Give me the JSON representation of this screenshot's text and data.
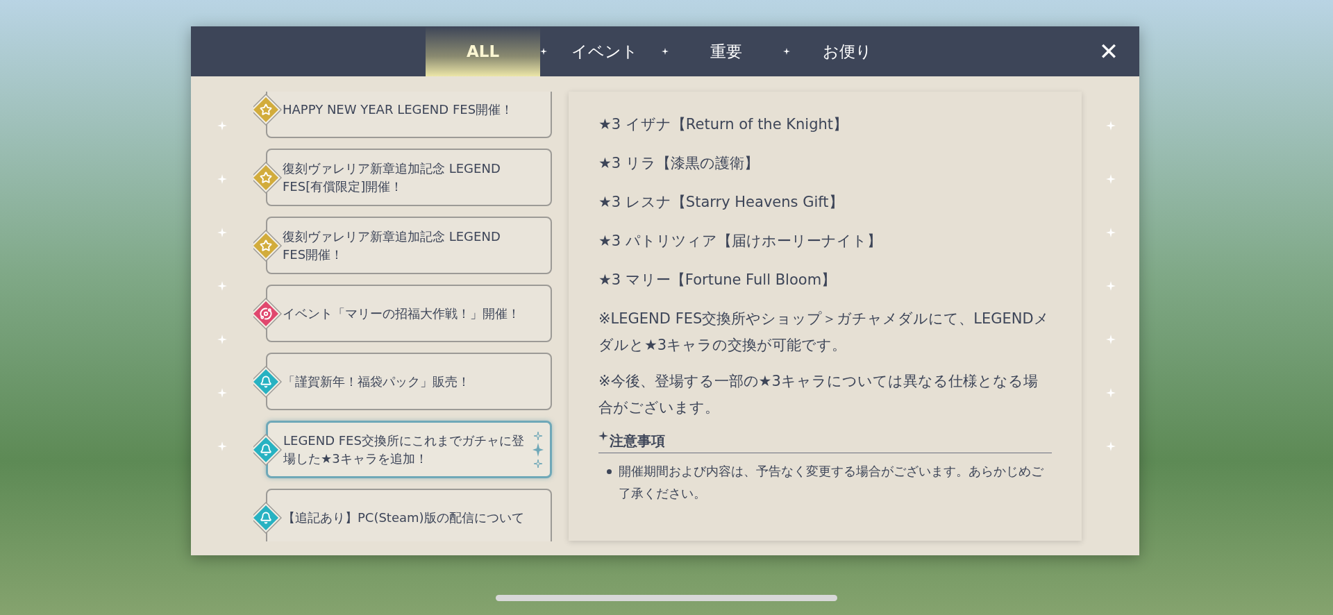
{
  "tabs": [
    {
      "label": "ALL",
      "selected": true
    },
    {
      "label": "イベント",
      "selected": false
    },
    {
      "label": "重要",
      "selected": false
    },
    {
      "label": "お便り",
      "selected": false
    }
  ],
  "close": "✕",
  "news": [
    {
      "kind": "star",
      "title": "HAPPY NEW YEAR LEGEND FES開催！",
      "selected": false
    },
    {
      "kind": "star",
      "title": "復刻ヴァレリア新章追加記念 LEGEND FES[有償限定]開催！",
      "selected": false
    },
    {
      "kind": "star",
      "title": "復刻ヴァレリア新章追加記念 LEGEND FES開催！",
      "selected": false
    },
    {
      "kind": "event",
      "title": "イベント「マリーの招福大作戦！」開催！",
      "selected": false
    },
    {
      "kind": "bell",
      "title": "「謹賀新年！福袋パック」販売！",
      "selected": false
    },
    {
      "kind": "bell",
      "title": "LEGEND FES交換所にこれまでガチャに登場した★3キャラを追加！",
      "selected": true
    },
    {
      "kind": "bell",
      "title": "【追記あり】PC(Steam)版の配信について",
      "selected": false
    }
  ],
  "article": {
    "lines": [
      "★3 イザナ【Return of the Knight】",
      "★3 リラ【漆黒の護衛】",
      "★3 レスナ【Starry Heavens Gift】",
      "★3 パトリツィア【届けホーリーナイト】",
      "★3 マリー【Fortune Full Bloom】"
    ],
    "paragraphs": [
      "※LEGEND FES交換所やショップ＞ガチャメダルにて、LEGENDメダルと★3キャラの交換が可能です。",
      "※今後、登場する一部の★3キャラについては異なる仕様となる場合がございます。"
    ],
    "notice": {
      "heading": "注意事項",
      "bullets": [
        "開催期間および内容は、予告なく変更する場合がございます。あらかじめご了承ください。"
      ]
    }
  }
}
